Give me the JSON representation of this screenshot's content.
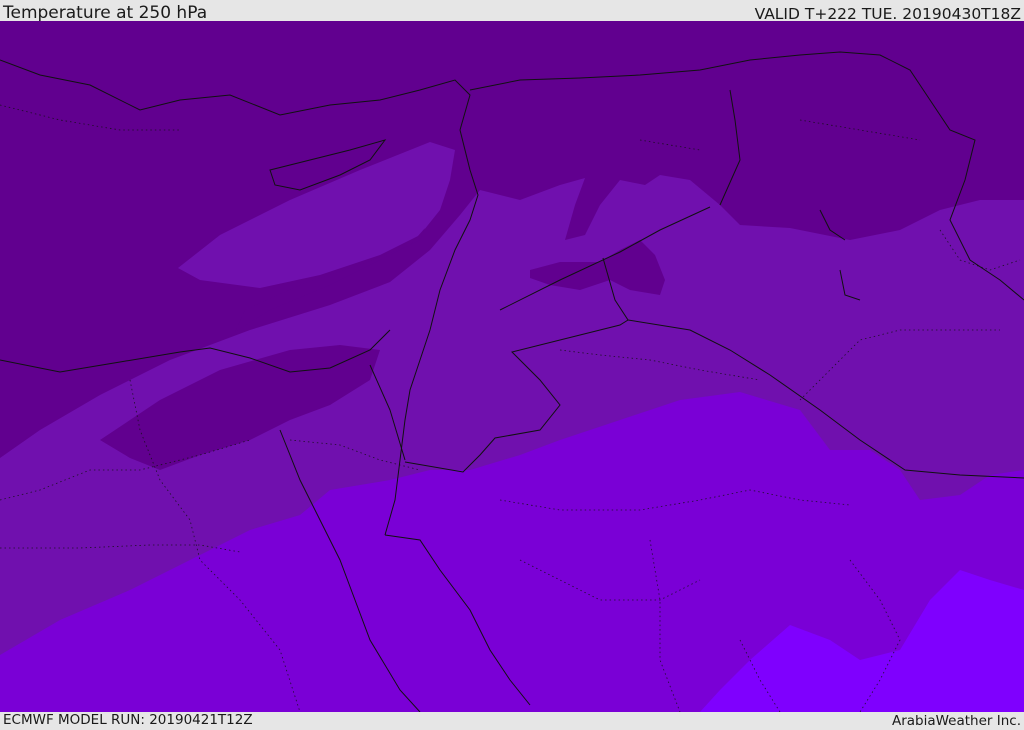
{
  "header": {
    "title": "Temperature at 250 hPa",
    "valid_time": "VALID T+222 TUE. 20190430T18Z"
  },
  "footer": {
    "model_run": "ECMWF MODEL RUN: 20190421T12Z",
    "credit": "ArabiaWeather Inc."
  },
  "map": {
    "colors": {
      "band_coldest": "#61008f",
      "band_cold": "#7010ae",
      "band_mid": "#7a00d6",
      "band_warm": "#7f00fe",
      "boundary": "#111111"
    }
  }
}
